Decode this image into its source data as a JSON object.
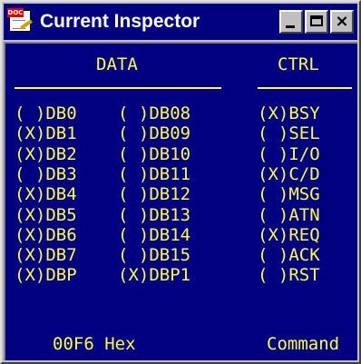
{
  "window": {
    "title": "Current Inspector",
    "icon": "doc-app-icon",
    "icon_tag": "DOC"
  },
  "data_section": {
    "header": "DATA",
    "left_column": [
      {
        "mark": "( )",
        "label": "DB0"
      },
      {
        "mark": "(X)",
        "label": "DB1"
      },
      {
        "mark": "(X)",
        "label": "DB2"
      },
      {
        "mark": "( )",
        "label": "DB3"
      },
      {
        "mark": "(X)",
        "label": "DB4"
      },
      {
        "mark": "(X)",
        "label": "DB5"
      },
      {
        "mark": "(X)",
        "label": "DB6"
      },
      {
        "mark": "(X)",
        "label": "DB7"
      },
      {
        "mark": "(X)",
        "label": "DBP"
      }
    ],
    "right_column": [
      {
        "mark": "( )",
        "label": "DB08"
      },
      {
        "mark": "( )",
        "label": "DB09"
      },
      {
        "mark": "( )",
        "label": "DB10"
      },
      {
        "mark": "( )",
        "label": "DB11"
      },
      {
        "mark": "( )",
        "label": "DB12"
      },
      {
        "mark": "( )",
        "label": "DB13"
      },
      {
        "mark": "( )",
        "label": "DB14"
      },
      {
        "mark": "( )",
        "label": "DB15"
      },
      {
        "mark": "(X)",
        "label": "DBP1"
      }
    ],
    "footer": "00F6 Hex"
  },
  "ctrl_section": {
    "header": "CTRL",
    "items": [
      {
        "mark": "(X)",
        "label": "BSY"
      },
      {
        "mark": "( )",
        "label": "SEL"
      },
      {
        "mark": "( )",
        "label": "I/O"
      },
      {
        "mark": "(X)",
        "label": "C/D"
      },
      {
        "mark": "( )",
        "label": "MSG"
      },
      {
        "mark": "( )",
        "label": "ATN"
      },
      {
        "mark": "(X)",
        "label": "REQ"
      },
      {
        "mark": "( )",
        "label": "ACK"
      },
      {
        "mark": "( )",
        "label": "RST"
      }
    ],
    "footer": "Command"
  },
  "colors": {
    "background": "#000080",
    "text": "#ffff40",
    "titlebar": "#000080",
    "frame": "#c0c0c0"
  }
}
